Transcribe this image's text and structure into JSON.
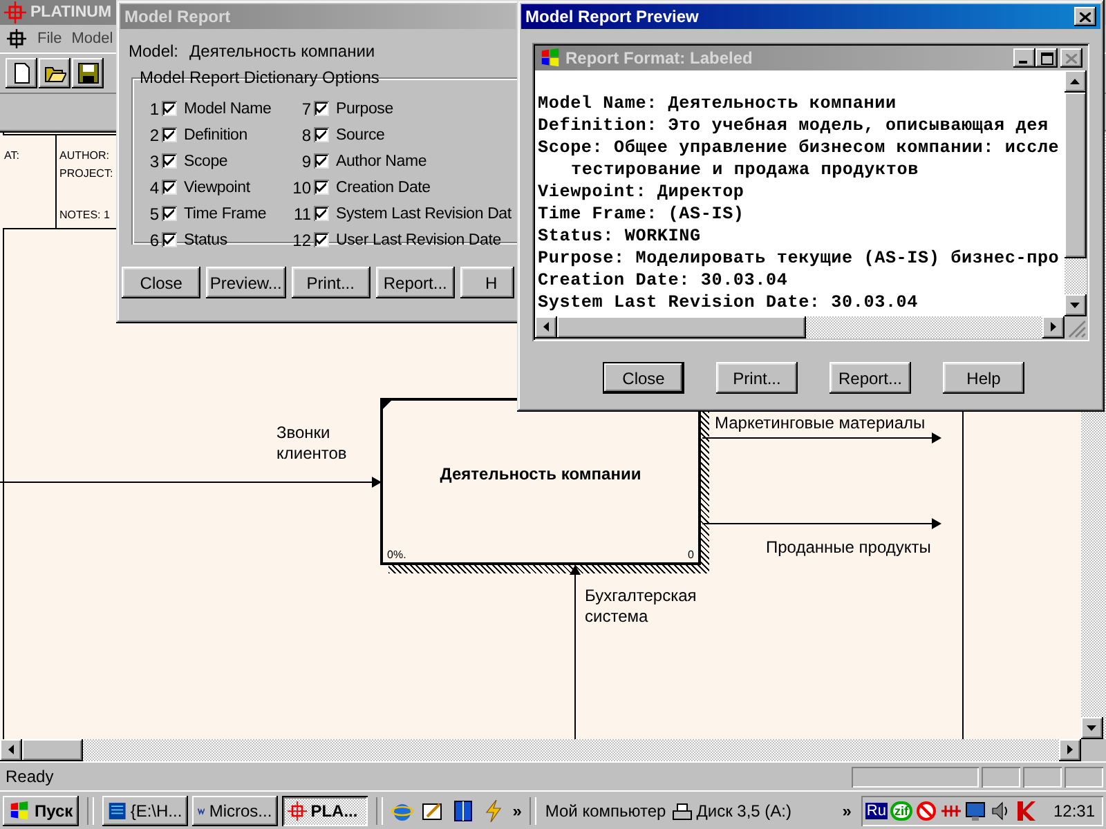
{
  "main_window": {
    "title": "PLATINUM",
    "menu": [
      "File",
      "Model"
    ]
  },
  "diagram": {
    "header": {
      "at": "AT:",
      "author": "AUTHOR:",
      "project": "PROJECT:",
      "notes": "NOTES: 1"
    },
    "activity": {
      "name": "Деятельность компании",
      "cost": "0%.",
      "number": "0"
    },
    "arrows": [
      {
        "label": "Звонки клиентов",
        "kind": "input"
      },
      {
        "label": "Маркетинговые материалы",
        "kind": "output"
      },
      {
        "label": "Проданные продукты",
        "kind": "output"
      },
      {
        "label": "Бухгалтерская система",
        "kind": "mechanism"
      }
    ]
  },
  "model_report": {
    "title": "Model Report",
    "model_label": "Model:",
    "model_name": "Деятельность компании",
    "group_title": "Model Report Dictionary Options",
    "options": [
      {
        "number": "1",
        "label": "Model Name",
        "checked": true
      },
      {
        "number": "2",
        "label": "Definition",
        "checked": true
      },
      {
        "number": "3",
        "label": "Scope",
        "checked": true
      },
      {
        "number": "4",
        "label": "Viewpoint",
        "checked": true
      },
      {
        "number": "5",
        "label": "Time Frame",
        "checked": true
      },
      {
        "number": "6",
        "label": "Status",
        "checked": true
      },
      {
        "number": "7",
        "label": "Purpose",
        "checked": true
      },
      {
        "number": "8",
        "label": "Source",
        "checked": true
      },
      {
        "number": "9",
        "label": "Author Name",
        "checked": true
      },
      {
        "number": "10",
        "label": "Creation Date",
        "checked": true
      },
      {
        "number": "11",
        "label": "System Last Revision Dat",
        "checked": true
      },
      {
        "number": "12",
        "label": "User Last Revision Date",
        "checked": true
      }
    ],
    "buttons": [
      "Close",
      "Preview...",
      "Print...",
      "Report...",
      "H"
    ]
  },
  "preview": {
    "title": "Model Report Preview",
    "inner_title": "Report Format: Labeled",
    "lines": [
      {
        "text": "Model Name: Деятельность компании",
        "kind": "field"
      },
      {
        "text": "Definition: Это учебная модель, описывающая дея",
        "kind": "field"
      },
      {
        "text": "Scope: Общее управление бизнесом компании: иссле",
        "kind": "field"
      },
      {
        "text": "тестирование и продажа продуктов",
        "kind": "continuation"
      },
      {
        "text": "Viewpoint: Директор",
        "kind": "field"
      },
      {
        "text": "Time Frame: (AS-IS)",
        "kind": "field"
      },
      {
        "text": "Status: WORKING",
        "kind": "field"
      },
      {
        "text": "Purpose: Моделировать текущие (AS-IS) бизнес-про",
        "kind": "field"
      },
      {
        "text": "Creation Date: 30.03.04",
        "kind": "field"
      },
      {
        "text": "System Last Revision Date: 30.03.04",
        "kind": "field"
      }
    ],
    "buttons": [
      "Close",
      "Print...",
      "Report...",
      "Help"
    ]
  },
  "status_bar": {
    "text": "Ready"
  },
  "taskbar": {
    "start": "Пуск",
    "tasks": [
      {
        "label": "{E:\\H...",
        "kind": "folder",
        "selected": false
      },
      {
        "label": "Micros...",
        "kind": "word",
        "selected": false
      },
      {
        "label": "PLA...",
        "kind": "platinum",
        "selected": true
      }
    ],
    "quick_more": "»",
    "address": "Мой компьютер",
    "drive": "Диск 3,5 (A:)",
    "tray_more": "»",
    "language": "Ru",
    "tray_badge": "zif",
    "clock": "12:31"
  }
}
